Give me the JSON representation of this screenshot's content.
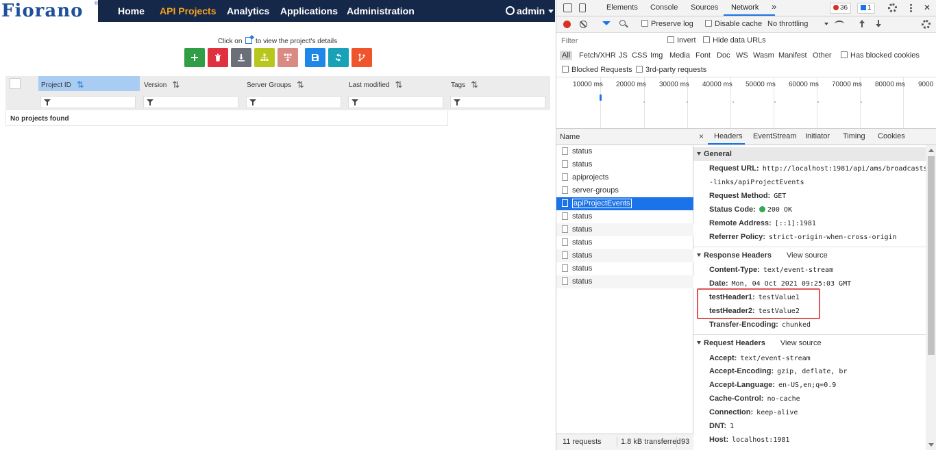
{
  "app": {
    "logo": "Fiorano",
    "logo_mark": "®",
    "nav": [
      {
        "label": "Home",
        "active": false
      },
      {
        "label": "API Projects",
        "active": true
      },
      {
        "label": "Analytics",
        "active": false
      },
      {
        "label": "Applications",
        "active": false
      },
      {
        "label": "Administration",
        "active": false
      }
    ],
    "user": "admin",
    "hint_before": "Click on",
    "hint_after": "to view the project's details",
    "toolbar": [
      {
        "icon": "plus-icon",
        "color": "#2f9e44"
      },
      {
        "icon": "trash-icon",
        "color": "#e03140"
      },
      {
        "icon": "download-icon",
        "color": "#6b7078"
      },
      {
        "icon": "hierarchy-icon",
        "color": "#b9c71d"
      },
      {
        "icon": "network-icon",
        "color": "#d98a82"
      },
      {
        "icon": "save-icon",
        "color": "#1f87e8"
      },
      {
        "icon": "refresh-icon",
        "color": "#17a2b8"
      },
      {
        "icon": "branch-icon",
        "color": "#f0542d"
      }
    ],
    "columns": [
      {
        "label": "Project ID",
        "active": true
      },
      {
        "label": "Version",
        "active": false
      },
      {
        "label": "Server Groups",
        "active": false
      },
      {
        "label": "Last modified",
        "active": false
      },
      {
        "label": "Tags",
        "active": false
      }
    ],
    "empty_message": "No projects found"
  },
  "devtools": {
    "tabs": [
      "Elements",
      "Console",
      "Sources",
      "Network"
    ],
    "active_tab": "Network",
    "more": "»",
    "error_count": "36",
    "message_count": "1",
    "toolbar": {
      "preserve_log": "Preserve log",
      "disable_cache": "Disable cache",
      "throttling": "No throttling"
    },
    "filter": {
      "placeholder": "Filter",
      "invert": "Invert",
      "hide_data_urls": "Hide data URLs",
      "types": [
        "All",
        "Fetch/XHR",
        "JS",
        "CSS",
        "Img",
        "Media",
        "Font",
        "Doc",
        "WS",
        "Wasm",
        "Manifest",
        "Other"
      ],
      "has_blocked_cookies": "Has blocked cookies",
      "blocked_requests": "Blocked Requests",
      "third_party": "3rd-party requests"
    },
    "timeline_labels": [
      "10000 ms",
      "20000 ms",
      "30000 ms",
      "40000 ms",
      "50000 ms",
      "60000 ms",
      "70000 ms",
      "80000 ms",
      "9000"
    ],
    "requests": {
      "header": "Name",
      "items": [
        "status",
        "status",
        "apiprojects",
        "server-groups",
        "apiProjectEvents",
        "status",
        "status",
        "status",
        "status",
        "status",
        "status"
      ],
      "selected_index": 4
    },
    "status_bar": {
      "requests": "11 requests",
      "transferred": "1.8 kB transferred",
      "extra": "93"
    },
    "detail_tabs": [
      "Headers",
      "EventStream",
      "Initiator",
      "Timing",
      "Cookies"
    ],
    "close": "×",
    "general": {
      "title": "General",
      "request_url_key": "Request URL:",
      "request_url_1": "http://localhost:1981/api/ams/broadcasts",
      "request_url_2": "-links/apiProjectEvents",
      "method_key": "Request Method:",
      "method": "GET",
      "status_key": "Status Code:",
      "status": "200 OK",
      "remote_key": "Remote Address:",
      "remote": "[::1]:1981",
      "referrer_key": "Referrer Policy:",
      "referrer": "strict-origin-when-cross-origin"
    },
    "response_headers": {
      "title": "Response Headers",
      "view_source": "View source",
      "items": [
        {
          "k": "Content-Type:",
          "v": "text/event-stream"
        },
        {
          "k": "Date:",
          "v": "Mon, 04 Oct 2021 09:25:03 GMT"
        },
        {
          "k": "testHeader1:",
          "v": "testValue1"
        },
        {
          "k": "testHeader2:",
          "v": "testValue2"
        },
        {
          "k": "Transfer-Encoding:",
          "v": "chunked"
        }
      ]
    },
    "request_headers": {
      "title": "Request Headers",
      "view_source": "View source",
      "items": [
        {
          "k": "Accept:",
          "v": "text/event-stream"
        },
        {
          "k": "Accept-Encoding:",
          "v": "gzip, deflate, br"
        },
        {
          "k": "Accept-Language:",
          "v": "en-US,en;q=0.9"
        },
        {
          "k": "Cache-Control:",
          "v": "no-cache"
        },
        {
          "k": "Connection:",
          "v": "keep-alive"
        },
        {
          "k": "DNT:",
          "v": "1"
        },
        {
          "k": "Host:",
          "v": "localhost:1981"
        }
      ]
    }
  }
}
